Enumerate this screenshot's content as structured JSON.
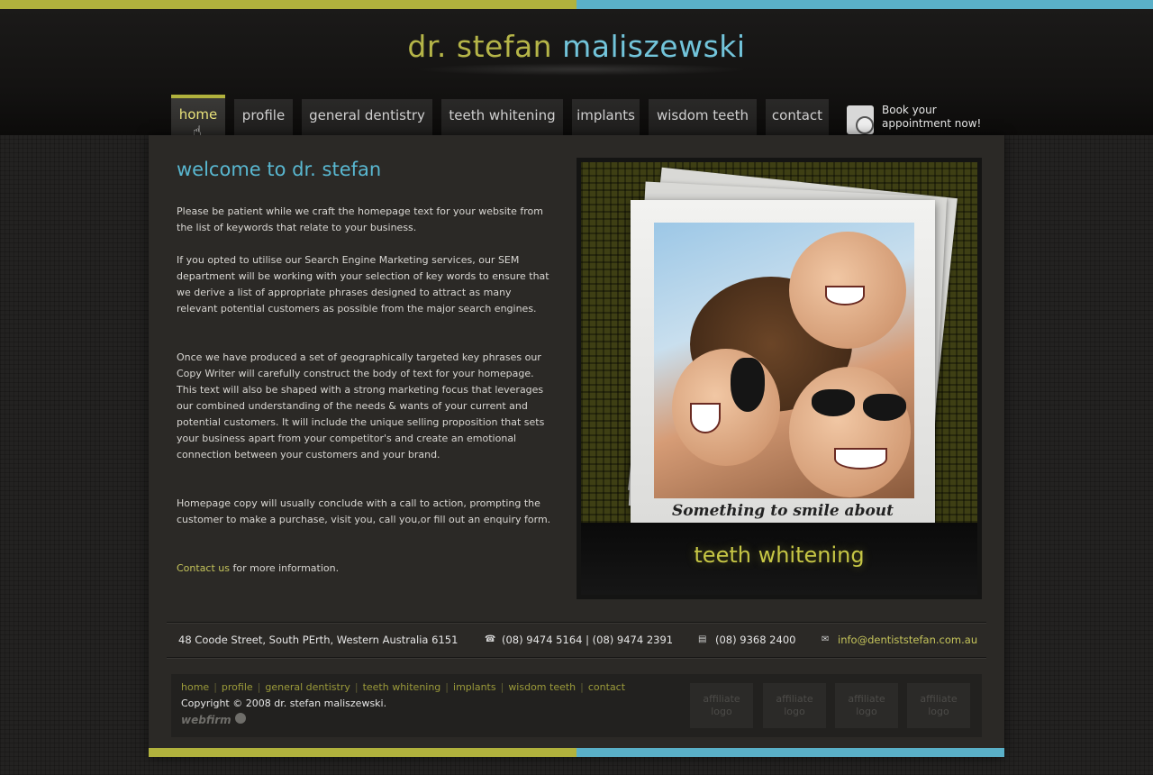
{
  "colors": {
    "accent_green": "#b1b23d",
    "accent_blue": "#5ab0c8",
    "link": "#c5c45b"
  },
  "logo": {
    "part1": "dr. stefan",
    "part2": "maliszewski"
  },
  "nav": [
    {
      "label": "home"
    },
    {
      "label": "profile"
    },
    {
      "label": "general dentistry"
    },
    {
      "label": "teeth whitening"
    },
    {
      "label": "implants"
    },
    {
      "label": "wisdom teeth"
    },
    {
      "label": "contact"
    }
  ],
  "book": {
    "line1": "Book your",
    "line2": "appointment now!",
    "icon": "calendar-clock-icon"
  },
  "main": {
    "title": "welcome to dr. stefan",
    "p1": "Please be patient while we craft the homepage text for your website from the list of keywords that relate to your business.",
    "p2": "If you opted to utilise our Search Engine Marketing services, our SEM department will be working with your selection of key words to ensure that we derive a list of appropriate phrases designed to attract as many relevant potential customers as possible from the major search engines.",
    "p3": "Once we have produced a set of geographically targeted key phrases our Copy Writer will carefully construct the body of text for your homepage. This text will also be shaped with a strong marketing focus that leverages our combined understanding of the needs & wants of your current and potential customers. It will include the unique selling proposition that sets your business apart from your competitor's and create an emotional connection between your customers and your brand.",
    "p4": "Homepage copy will usually conclude with a call to action, prompting the customer to make a purchase, visit you, call you,or fill out an enquiry form.",
    "contact_link": "Contact us",
    "contact_rest": " for more information."
  },
  "feature": {
    "caption": "Something to smile about",
    "band": "teeth whitening"
  },
  "contact_bar": {
    "address": "48 Coode Street, South PErth, Western Australia 6151",
    "phone": "(08) 9474 5164 | (08) 9474 2391",
    "fax": "(08) 9368 2400",
    "email": "info@dentiststefan.com.au"
  },
  "footer": {
    "links": [
      "home",
      "profile",
      "general dentistry",
      "teeth whitening",
      "implants",
      "wisdom teeth",
      "contact"
    ],
    "separator": "|",
    "copyright": "Copyright © 2008 dr. stefan maliszewski.",
    "credit": "webfirm",
    "affiliate_line1": "affiliate",
    "affiliate_line2": "logo"
  }
}
